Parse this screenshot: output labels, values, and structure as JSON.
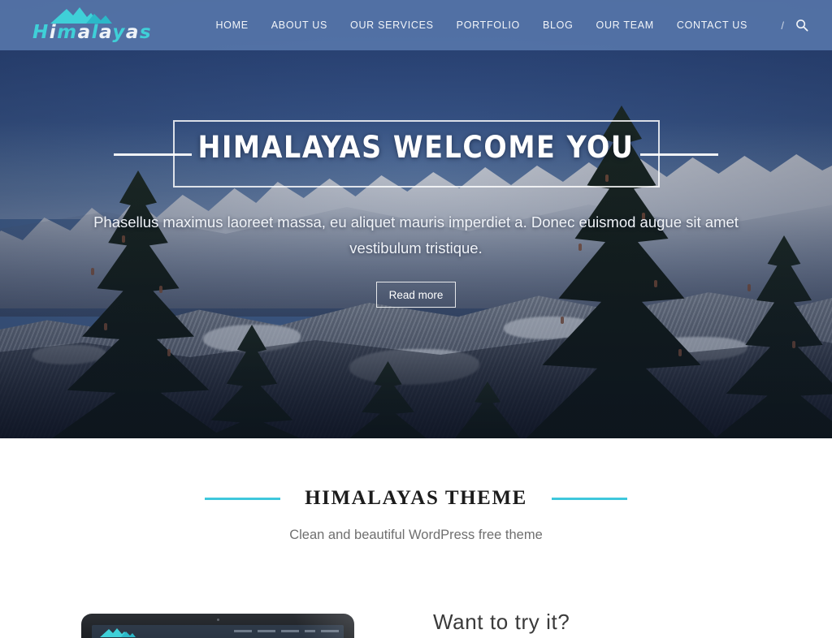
{
  "header": {
    "logo": {
      "icon": "mountain-logo-icon",
      "text_letters": [
        {
          "ch": "H",
          "style": "cyan"
        },
        {
          "ch": "i",
          "style": "white"
        },
        {
          "ch": "m",
          "style": "cyan"
        },
        {
          "ch": "a",
          "style": "white"
        },
        {
          "ch": "l",
          "style": "cyan"
        },
        {
          "ch": "a",
          "style": "white"
        },
        {
          "ch": "y",
          "style": "cyan"
        },
        {
          "ch": "a",
          "style": "white"
        },
        {
          "ch": "s",
          "style": "cyan"
        }
      ],
      "text": "Himalayas"
    },
    "nav_items": [
      {
        "label": "HOME",
        "name": "nav-home"
      },
      {
        "label": "ABOUT US",
        "name": "nav-about-us"
      },
      {
        "label": "OUR SERVICES",
        "name": "nav-our-services"
      },
      {
        "label": "PORTFOLIO",
        "name": "nav-portfolio"
      },
      {
        "label": "BLOG",
        "name": "nav-blog"
      },
      {
        "label": "OUR TEAM",
        "name": "nav-our-team"
      },
      {
        "label": "CONTACT US",
        "name": "nav-contact-us"
      }
    ],
    "separator": "/",
    "search_icon": "search-icon",
    "bg_color": "#5878ac"
  },
  "hero": {
    "title": "HIMALAYAS WELCOME YOU",
    "subtitle": "Phasellus maximus laoreet massa, eu aliquet mauris imperdiet a. Donec euismod augue sit amet vestibulum tristique.",
    "button_label": "Read more",
    "image_description": "snow-covered himalayan mountain range with dark conifer trees in foreground under deep blue sky"
  },
  "section": {
    "title": "HIMALAYAS THEME",
    "subtitle": "Clean and beautiful WordPress free theme",
    "accent_color": "#3ec7dc"
  },
  "promo": {
    "heading": "Want to try it?",
    "laptop_screen_logo": "mountain-logo-icon"
  },
  "colors": {
    "accent_cyan": "#3ec7dc",
    "logo_cyan": "#3fd0d8",
    "header_blue": "#5878ac",
    "heading_dark": "#1c1c1c",
    "body_gray": "#6f6f6f"
  }
}
